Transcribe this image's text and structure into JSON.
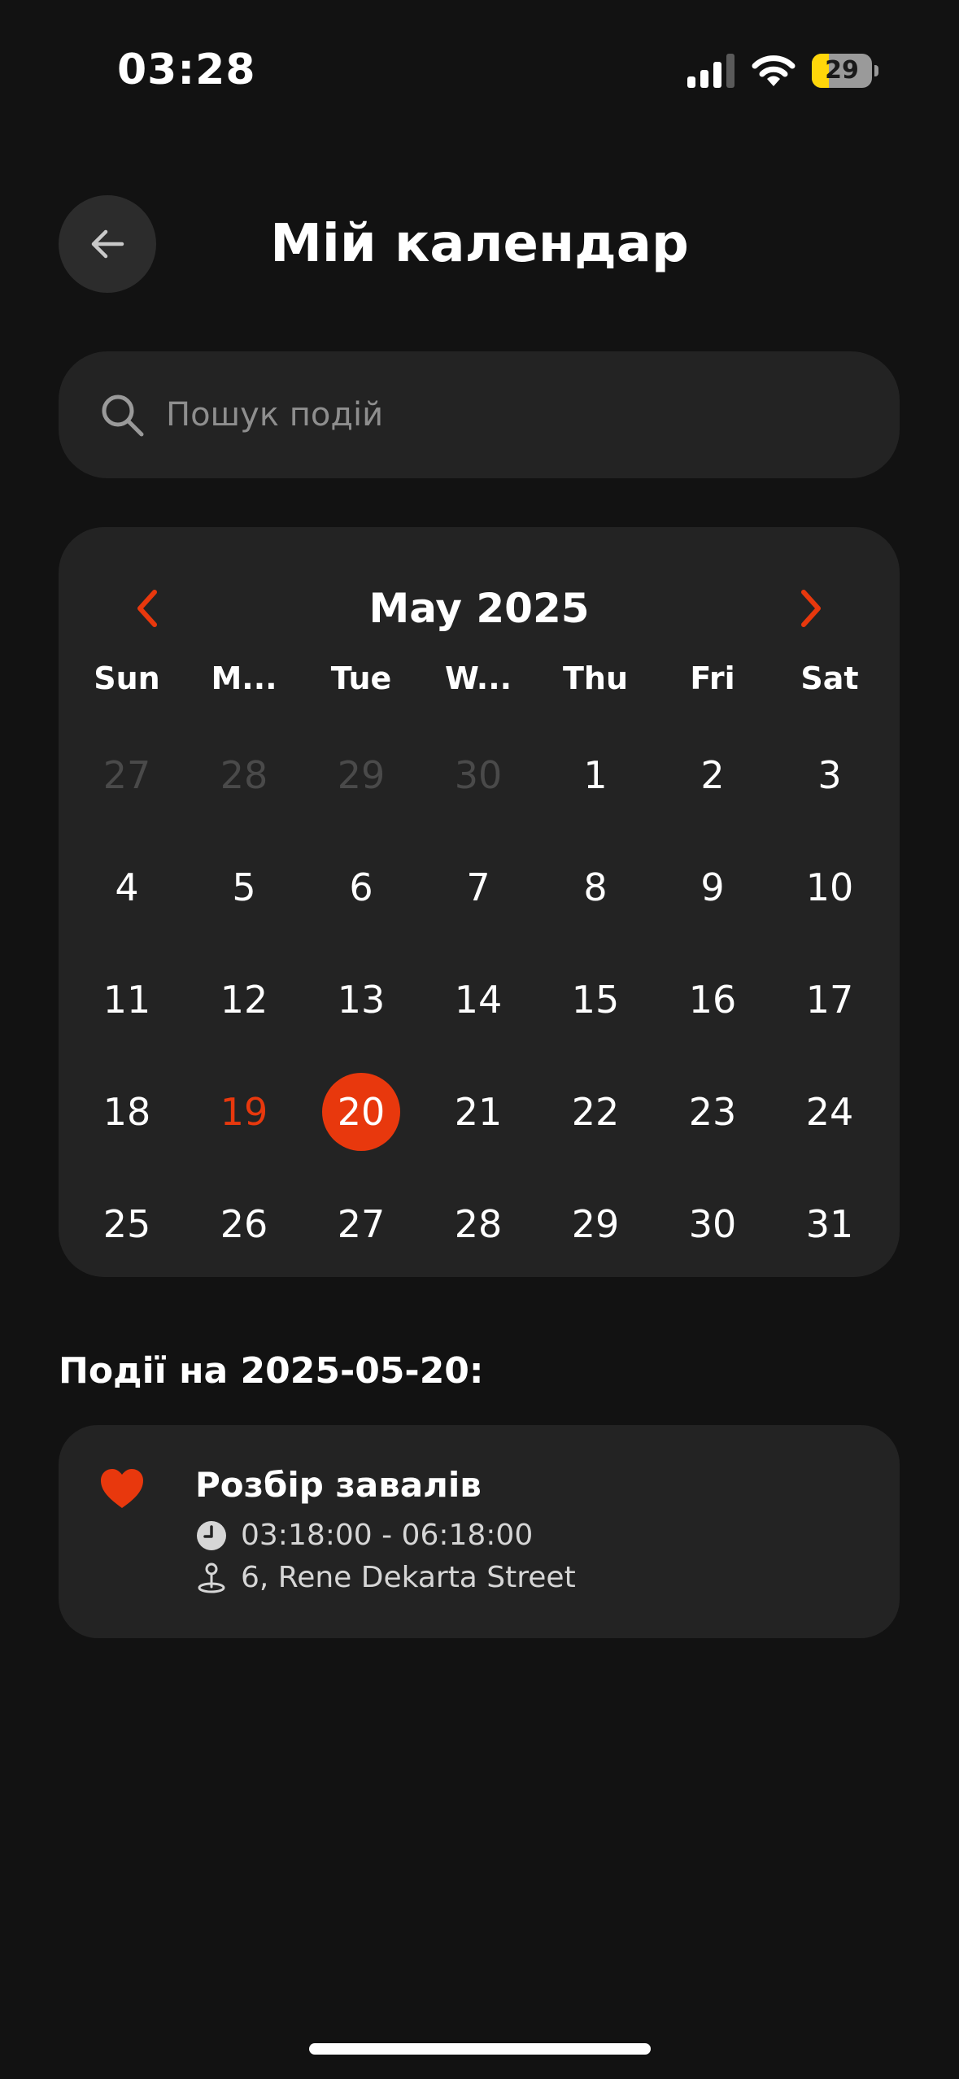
{
  "status_bar": {
    "time": "03:28",
    "battery_level": "29",
    "battery_fraction": 0.29
  },
  "header": {
    "title": "Мій календар",
    "back_icon": "arrow-left-icon"
  },
  "search": {
    "placeholder": "Пошук подій",
    "value": "",
    "icon": "search-icon"
  },
  "calendar": {
    "month_label": "May 2025",
    "prev_icon": "chevron-left-icon",
    "next_icon": "chevron-right-icon",
    "weekdays": [
      "Sun",
      "M...",
      "Tue",
      "W...",
      "Thu",
      "Fri",
      "Sat"
    ],
    "days": [
      {
        "label": "27",
        "state": "muted"
      },
      {
        "label": "28",
        "state": "muted"
      },
      {
        "label": "29",
        "state": "muted"
      },
      {
        "label": "30",
        "state": "muted"
      },
      {
        "label": "1",
        "state": "normal"
      },
      {
        "label": "2",
        "state": "normal"
      },
      {
        "label": "3",
        "state": "normal"
      },
      {
        "label": "4",
        "state": "normal"
      },
      {
        "label": "5",
        "state": "normal"
      },
      {
        "label": "6",
        "state": "normal"
      },
      {
        "label": "7",
        "state": "normal"
      },
      {
        "label": "8",
        "state": "normal"
      },
      {
        "label": "9",
        "state": "normal"
      },
      {
        "label": "10",
        "state": "normal"
      },
      {
        "label": "11",
        "state": "normal"
      },
      {
        "label": "12",
        "state": "normal"
      },
      {
        "label": "13",
        "state": "normal"
      },
      {
        "label": "14",
        "state": "normal"
      },
      {
        "label": "15",
        "state": "normal"
      },
      {
        "label": "16",
        "state": "normal"
      },
      {
        "label": "17",
        "state": "normal"
      },
      {
        "label": "18",
        "state": "normal"
      },
      {
        "label": "19",
        "state": "today"
      },
      {
        "label": "20",
        "state": "selected"
      },
      {
        "label": "21",
        "state": "normal"
      },
      {
        "label": "22",
        "state": "normal"
      },
      {
        "label": "23",
        "state": "normal"
      },
      {
        "label": "24",
        "state": "normal"
      },
      {
        "label": "25",
        "state": "normal"
      },
      {
        "label": "26",
        "state": "normal"
      },
      {
        "label": "27",
        "state": "normal"
      },
      {
        "label": "28",
        "state": "normal"
      },
      {
        "label": "29",
        "state": "normal"
      },
      {
        "label": "30",
        "state": "normal"
      },
      {
        "label": "31",
        "state": "normal"
      }
    ]
  },
  "events": {
    "heading": "Події на 2025-05-20:",
    "items": [
      {
        "title": "Розбір завалів",
        "time": "03:18:00 - 06:18:00",
        "location": "6, Rene Dekarta Street",
        "icon": "heart-icon"
      }
    ]
  },
  "colors": {
    "background": "#121212",
    "card": "#232323",
    "accent": "#e8380d",
    "muted_text": "#4a4a4a",
    "battery_yellow": "#ffd60a"
  }
}
